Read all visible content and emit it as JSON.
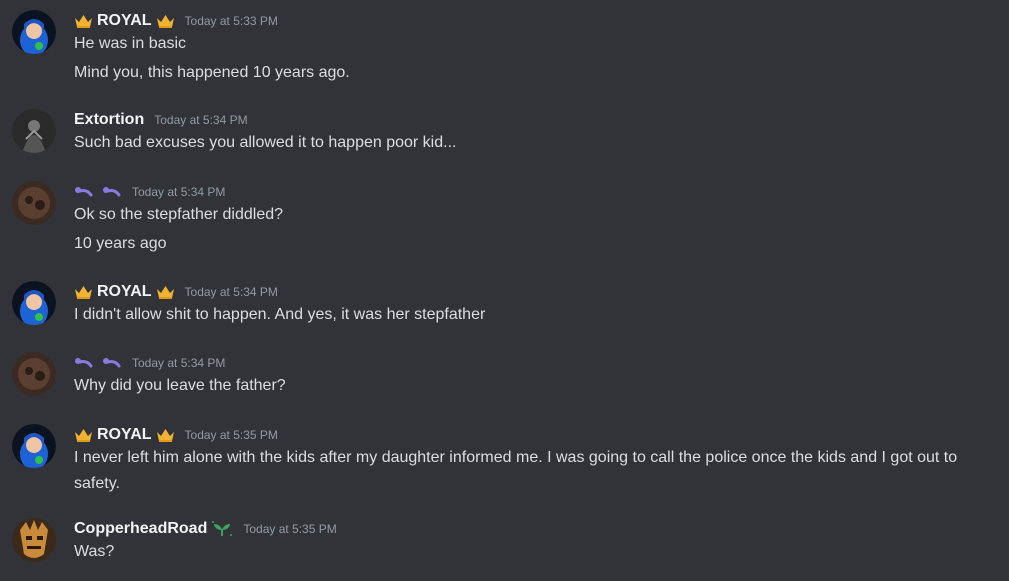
{
  "colors": {
    "background": "#313338",
    "username": "#f2f3f5",
    "text": "#dbdee1",
    "timestamp": "#949ba4",
    "crown": "#f0b232",
    "pill_purple": "#8a7ae0",
    "leaf_green": "#3ba55d"
  },
  "messages": [
    {
      "username": "ROYAL",
      "badge_left": "crown-icon",
      "badge_right": "crown-icon",
      "timestamp": "Today at 5:33 PM",
      "lines": [
        "He was in basic",
        "Mind you, this happened 10 years ago."
      ]
    },
    {
      "username": "Extortion",
      "timestamp": "Today at 5:34 PM",
      "lines": [
        "Such bad excuses you allowed it to happen poor kid..."
      ]
    },
    {
      "username": "",
      "badges": [
        "pill-icon",
        "pill-icon"
      ],
      "timestamp": "Today at 5:34 PM",
      "lines": [
        "Ok so the stepfather diddled?",
        "10 years ago"
      ]
    },
    {
      "username": "ROYAL",
      "badge_left": "crown-icon",
      "badge_right": "crown-icon",
      "timestamp": "Today at 5:34 PM",
      "lines": [
        "I didn't allow shit to happen. And yes, it was her stepfather"
      ]
    },
    {
      "username": "",
      "badges": [
        "pill-icon",
        "pill-icon"
      ],
      "timestamp": "Today at 5:34 PM",
      "lines": [
        "Why did you leave the father?"
      ]
    },
    {
      "username": "ROYAL",
      "badge_left": "crown-icon",
      "badge_right": "crown-icon",
      "timestamp": "Today at 5:35 PM",
      "lines": [
        "I never left him alone with the kids after my daughter informed me. I was going to call the police once the kids and I got out to safety."
      ]
    },
    {
      "username": "CopperheadRoad",
      "badge_right": "sprout-icon",
      "timestamp": "Today at 5:35 PM",
      "lines": [
        "Was?"
      ]
    }
  ]
}
